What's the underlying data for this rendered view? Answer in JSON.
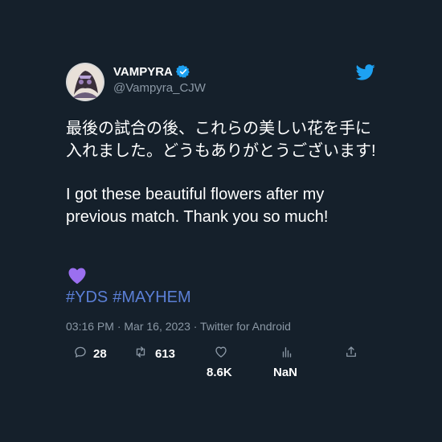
{
  "colors": {
    "background": "#15202b",
    "text_primary": "#ffffff",
    "text_secondary": "#8b98a5",
    "accent_blue": "#1da1f2",
    "hashtag": "#5b7fd6",
    "heart_purple": "#9b6ff0"
  },
  "author": {
    "display_name": "VAMPYRA",
    "handle": "@Vampyra_CJW",
    "verified": true
  },
  "tweet": {
    "text_japanese": "最後の試合の後、これらの美しい花を手に入れました。どうもありがとうございます!",
    "text_english": "I got these beautiful flowers after my previous match. Thank you so much!",
    "emoji": "purple-heart",
    "hashtags": [
      "#YDS",
      "#MAYHEM"
    ],
    "timestamp": "03:16 PM · Mar 16, 2023 · Twitter for Android"
  },
  "actions": {
    "reply_count": "28",
    "retweet_count": "613",
    "like_count": "8.6K",
    "views_count": "NaN"
  }
}
